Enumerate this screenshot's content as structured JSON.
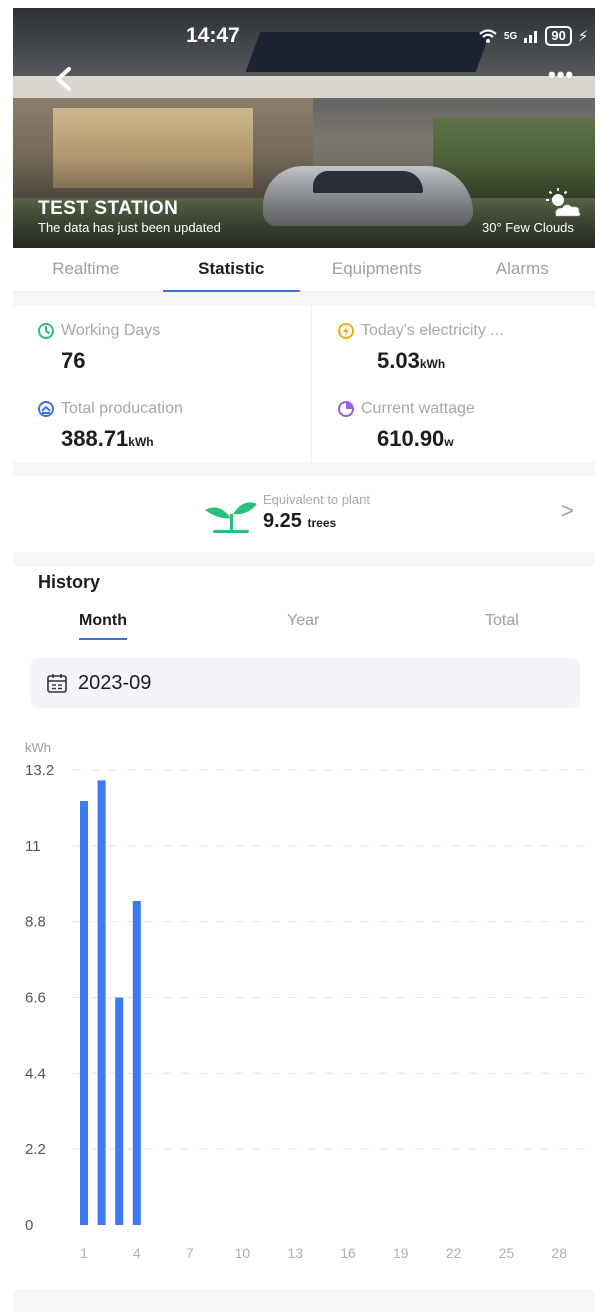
{
  "status_bar": {
    "time": "14:47",
    "network": "5G",
    "battery": "90"
  },
  "header": {
    "station_name": "TEST STATION",
    "subtitle": "The data has just been updated",
    "weather": "30° Few Clouds"
  },
  "tabs": [
    {
      "label": "Realtime",
      "active": false
    },
    {
      "label": "Statistic",
      "active": true
    },
    {
      "label": "Equipments",
      "active": false
    },
    {
      "label": "Alarms",
      "active": false
    }
  ],
  "stats": {
    "working_days": {
      "label": "Working Days",
      "value": "76",
      "unit": "",
      "icon": "clock-icon",
      "color": "#2bbf7e"
    },
    "today_electricity": {
      "label": "Today's electricity ...",
      "value": "5.03",
      "unit": "kWh",
      "icon": "bolt-icon",
      "color": "#f2a91a"
    },
    "total_production": {
      "label": "Total producation",
      "value": "388.71",
      "unit": "kWh",
      "icon": "gauge-icon",
      "color": "#3b72e6"
    },
    "current_wattage": {
      "label": "Current wattage",
      "value": "610.90",
      "unit": "w",
      "icon": "pie-icon",
      "color": "#9b5de5"
    }
  },
  "equivalent": {
    "label": "Equivalent to plant",
    "value": "9.25",
    "unit": "trees"
  },
  "history": {
    "title": "History",
    "tabs": [
      {
        "label": "Month",
        "active": true
      },
      {
        "label": "Year",
        "active": false
      },
      {
        "label": "Total",
        "active": false
      }
    ],
    "date": "2023-09"
  },
  "chart_data": {
    "type": "bar",
    "ylabel": "kWh",
    "ylim": [
      0,
      13.2
    ],
    "yticks": [
      "0",
      "2.2",
      "4.4",
      "6.6",
      "8.8",
      "11",
      "13.2"
    ],
    "xticks": [
      "1",
      "4",
      "7",
      "10",
      "13",
      "16",
      "19",
      "22",
      "25",
      "28"
    ],
    "x": [
      1,
      2,
      3,
      4
    ],
    "values": [
      12.3,
      12.9,
      6.6,
      9.4
    ],
    "bar_color": "#3b7bef",
    "grid": "dashed horizontal"
  }
}
